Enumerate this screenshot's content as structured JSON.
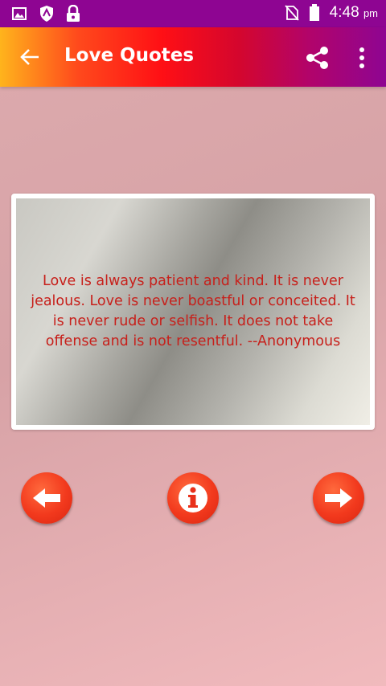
{
  "status_bar": {
    "time": "4:48",
    "ampm": "pm",
    "icons": [
      "image-icon",
      "shield-icon",
      "lock-icon",
      "no-sim-icon",
      "battery-icon"
    ]
  },
  "app_bar": {
    "title": "Love Quotes",
    "icons": [
      "back-arrow-icon",
      "share-icon",
      "more-vert-icon"
    ]
  },
  "quote": {
    "text": "Love is always patient and kind. It is never jealous. Love is never boastful or conceited. It is never rude or selfish. It does not take offense and is not resentful. --Anonymous"
  },
  "controls": {
    "icons": [
      "arrow-left-icon",
      "info-icon",
      "arrow-right-icon"
    ],
    "colors": {
      "button": "#f2391d",
      "glyph": "#ffffff",
      "quote_text": "#c7201b"
    }
  },
  "colors": {
    "status_bar": "#8e0592",
    "app_bar_gradient": [
      "#ffb41c",
      "#ff0f15",
      "#8e0592"
    ],
    "background": "#d7a2a6"
  }
}
